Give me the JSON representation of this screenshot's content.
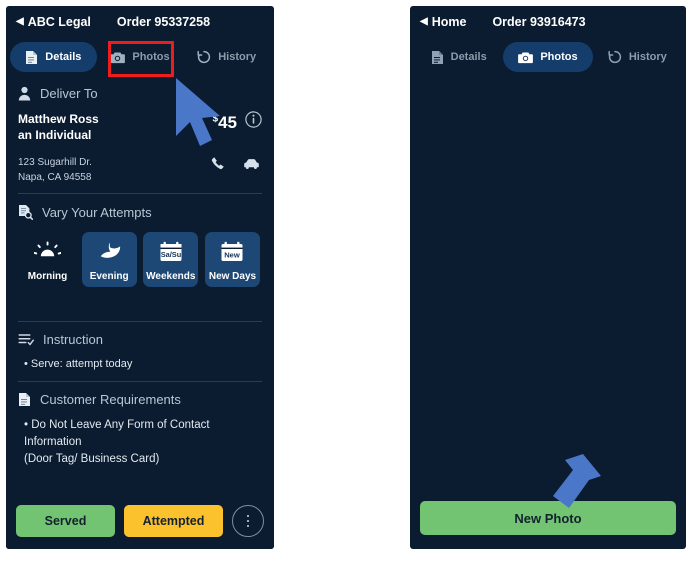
{
  "left_phone": {
    "header": {
      "back_label": "ABC Legal",
      "order_title": "Order 95337258"
    },
    "tabs": [
      {
        "label": "Details",
        "icon": "document-icon",
        "active": true
      },
      {
        "label": "Photos",
        "icon": "camera-icon",
        "active": false
      },
      {
        "label": "History",
        "icon": "history-icon",
        "active": false
      }
    ],
    "deliver_to": {
      "heading": "Deliver To",
      "heading_icon": "person-icon",
      "recipient_name": "Matthew Ross",
      "recipient_type": "an Individual",
      "currency_symbol": "$",
      "price": "45",
      "info_icon": "info-icon",
      "address_line1": "123 Sugarhill Dr.",
      "address_line2": "Napa, CA 94558",
      "phone_icon": "phone-icon",
      "car_icon": "car-icon"
    },
    "vary_attempts": {
      "heading": "Vary Your Attempts",
      "heading_icon": "document-search-icon",
      "options": [
        {
          "label": "Morning",
          "icon": "sun-icon",
          "selected": false
        },
        {
          "label": "Evening",
          "icon": "moon-icon",
          "selected": true
        },
        {
          "label": "Weekends",
          "icon": "calendar-weekend-icon",
          "badge": "Sa/Su",
          "selected": true
        },
        {
          "label": "New Days",
          "icon": "calendar-new-icon",
          "badge": "New",
          "selected": true
        }
      ]
    },
    "instruction": {
      "heading": "Instruction",
      "heading_icon": "list-check-icon",
      "items": [
        "• Serve: attempt today"
      ]
    },
    "customer_requirements": {
      "heading": "Customer Requirements",
      "heading_icon": "document-icon",
      "items": [
        "• Do Not Leave Any Form of Contact Information",
        "(Door Tag/ Business Card)"
      ]
    },
    "actions": {
      "served_label": "Served",
      "attempted_label": "Attempted",
      "more_icon": "kebab-menu-icon"
    }
  },
  "right_phone": {
    "header": {
      "back_label": "Home",
      "order_title": "Order 93916473"
    },
    "tabs": [
      {
        "label": "Details",
        "icon": "document-icon",
        "active": false
      },
      {
        "label": "Photos",
        "icon": "camera-icon",
        "active": true
      },
      {
        "label": "History",
        "icon": "history-icon",
        "active": false
      }
    ],
    "new_photo_label": "New Photo"
  },
  "annotations": {
    "highlight_color": "#ee1c1c",
    "cursor_color": "#4a77c8",
    "arrow_color": "#4a77c8"
  },
  "colors": {
    "phone_background": "#0b1c30",
    "tab_active": "#143d6b",
    "tile_selected": "#1d4875",
    "served_green": "#72c472",
    "attempted_yellow": "#fbc22e"
  }
}
